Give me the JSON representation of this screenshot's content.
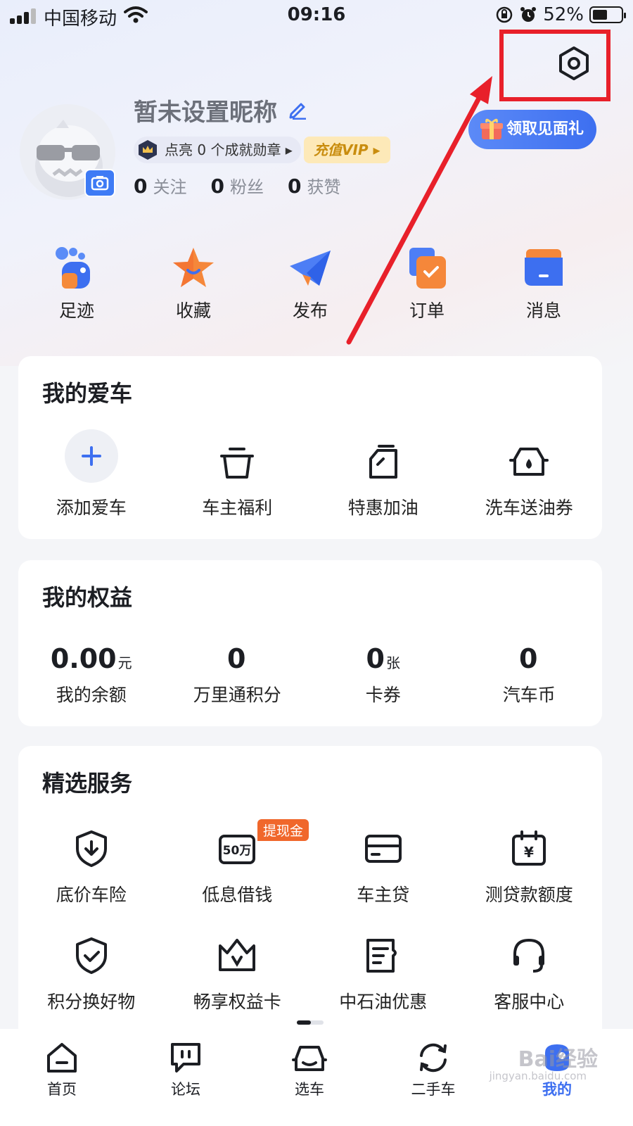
{
  "status": {
    "carrier": "中国移动",
    "time": "09:16",
    "battery": "52%",
    "battery_level": 0.52
  },
  "profile": {
    "nickname": "暂未设置昵称",
    "badge_text": "点亮 0 个成就勋章",
    "vip_text": "充值VIP",
    "gift_button": "领取见面礼",
    "follow_count": "0",
    "follow_label": "关注",
    "fans_count": "0",
    "fans_label": "粉丝",
    "likes_count": "0",
    "likes_label": "获赞"
  },
  "quick_nav": [
    {
      "label": "足迹",
      "icon": "footprint-icon"
    },
    {
      "label": "收藏",
      "icon": "star-icon"
    },
    {
      "label": "发布",
      "icon": "paper-plane-icon"
    },
    {
      "label": "订单",
      "icon": "order-icon"
    },
    {
      "label": "消息",
      "icon": "message-icon"
    }
  ],
  "my_car": {
    "title": "我的爱车",
    "items": [
      {
        "label": "添加爱车",
        "icon": "plus-icon"
      },
      {
        "label": "车主福利",
        "icon": "gift-box-icon"
      },
      {
        "label": "特惠加油",
        "icon": "fuel-can-icon"
      },
      {
        "label": "洗车送油券",
        "icon": "car-wash-icon"
      }
    ]
  },
  "benefits": {
    "title": "我的权益",
    "items": [
      {
        "value": "0.00",
        "unit": "元",
        "label": "我的余额"
      },
      {
        "value": "0",
        "unit": "",
        "label": "万里通积分"
      },
      {
        "value": "0",
        "unit": "张",
        "label": "卡券"
      },
      {
        "value": "0",
        "unit": "",
        "label": "汽车币"
      }
    ]
  },
  "services": {
    "title": "精选服务",
    "tag": "提现金",
    "row1": [
      {
        "label": "底价车险",
        "icon": "shield-download-icon"
      },
      {
        "label": "低息借钱",
        "icon": "loan-50w-icon",
        "icon_text": "50万"
      },
      {
        "label": "车主贷",
        "icon": "card-icon"
      },
      {
        "label": "测贷款额度",
        "icon": "calendar-yen-icon",
        "icon_text": "¥"
      }
    ],
    "row2": [
      {
        "label": "积分换好物",
        "icon": "shield-check-icon"
      },
      {
        "label": "畅享权益卡",
        "icon": "crown-card-icon"
      },
      {
        "label": "中石油优惠",
        "icon": "coupon-icon"
      },
      {
        "label": "客服中心",
        "icon": "headset-icon"
      }
    ]
  },
  "tabbar": [
    {
      "label": "首页",
      "icon": "home-icon"
    },
    {
      "label": "论坛",
      "icon": "forum-icon"
    },
    {
      "label": "选车",
      "icon": "car-icon"
    },
    {
      "label": "二手车",
      "icon": "refresh-icon"
    },
    {
      "label": "我的",
      "icon": "profile-icon",
      "active": true
    }
  ],
  "watermark": {
    "main": "Bai经验",
    "sub": "jingyan.baidu.com"
  },
  "colors": {
    "accent": "#3d6ff0",
    "annotation": "#e8202a",
    "tag": "#f0672b",
    "vip": "#c98d0f"
  }
}
